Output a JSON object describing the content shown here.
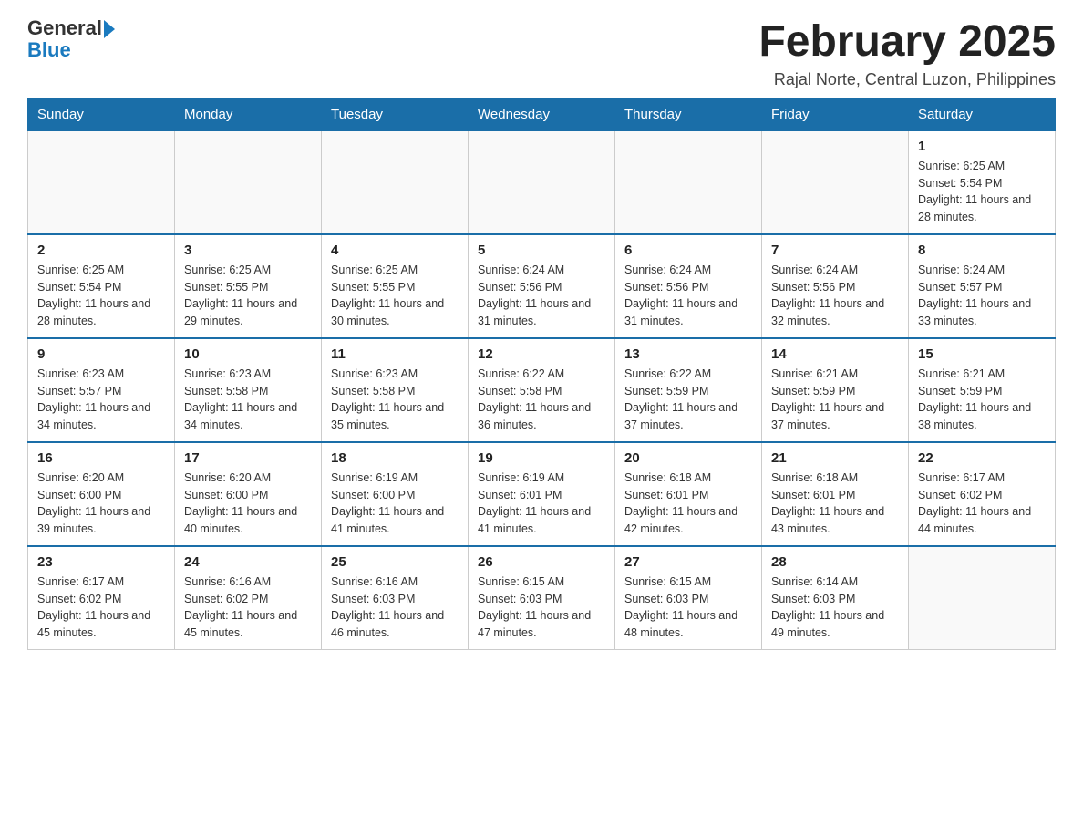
{
  "header": {
    "logo_general": "General",
    "logo_blue": "Blue",
    "month_title": "February 2025",
    "location": "Rajal Norte, Central Luzon, Philippines"
  },
  "days_of_week": [
    "Sunday",
    "Monday",
    "Tuesday",
    "Wednesday",
    "Thursday",
    "Friday",
    "Saturday"
  ],
  "weeks": [
    [
      {
        "day": "",
        "info": ""
      },
      {
        "day": "",
        "info": ""
      },
      {
        "day": "",
        "info": ""
      },
      {
        "day": "",
        "info": ""
      },
      {
        "day": "",
        "info": ""
      },
      {
        "day": "",
        "info": ""
      },
      {
        "day": "1",
        "info": "Sunrise: 6:25 AM\nSunset: 5:54 PM\nDaylight: 11 hours and 28 minutes."
      }
    ],
    [
      {
        "day": "2",
        "info": "Sunrise: 6:25 AM\nSunset: 5:54 PM\nDaylight: 11 hours and 28 minutes."
      },
      {
        "day": "3",
        "info": "Sunrise: 6:25 AM\nSunset: 5:55 PM\nDaylight: 11 hours and 29 minutes."
      },
      {
        "day": "4",
        "info": "Sunrise: 6:25 AM\nSunset: 5:55 PM\nDaylight: 11 hours and 30 minutes."
      },
      {
        "day": "5",
        "info": "Sunrise: 6:24 AM\nSunset: 5:56 PM\nDaylight: 11 hours and 31 minutes."
      },
      {
        "day": "6",
        "info": "Sunrise: 6:24 AM\nSunset: 5:56 PM\nDaylight: 11 hours and 31 minutes."
      },
      {
        "day": "7",
        "info": "Sunrise: 6:24 AM\nSunset: 5:56 PM\nDaylight: 11 hours and 32 minutes."
      },
      {
        "day": "8",
        "info": "Sunrise: 6:24 AM\nSunset: 5:57 PM\nDaylight: 11 hours and 33 minutes."
      }
    ],
    [
      {
        "day": "9",
        "info": "Sunrise: 6:23 AM\nSunset: 5:57 PM\nDaylight: 11 hours and 34 minutes."
      },
      {
        "day": "10",
        "info": "Sunrise: 6:23 AM\nSunset: 5:58 PM\nDaylight: 11 hours and 34 minutes."
      },
      {
        "day": "11",
        "info": "Sunrise: 6:23 AM\nSunset: 5:58 PM\nDaylight: 11 hours and 35 minutes."
      },
      {
        "day": "12",
        "info": "Sunrise: 6:22 AM\nSunset: 5:58 PM\nDaylight: 11 hours and 36 minutes."
      },
      {
        "day": "13",
        "info": "Sunrise: 6:22 AM\nSunset: 5:59 PM\nDaylight: 11 hours and 37 minutes."
      },
      {
        "day": "14",
        "info": "Sunrise: 6:21 AM\nSunset: 5:59 PM\nDaylight: 11 hours and 37 minutes."
      },
      {
        "day": "15",
        "info": "Sunrise: 6:21 AM\nSunset: 5:59 PM\nDaylight: 11 hours and 38 minutes."
      }
    ],
    [
      {
        "day": "16",
        "info": "Sunrise: 6:20 AM\nSunset: 6:00 PM\nDaylight: 11 hours and 39 minutes."
      },
      {
        "day": "17",
        "info": "Sunrise: 6:20 AM\nSunset: 6:00 PM\nDaylight: 11 hours and 40 minutes."
      },
      {
        "day": "18",
        "info": "Sunrise: 6:19 AM\nSunset: 6:00 PM\nDaylight: 11 hours and 41 minutes."
      },
      {
        "day": "19",
        "info": "Sunrise: 6:19 AM\nSunset: 6:01 PM\nDaylight: 11 hours and 41 minutes."
      },
      {
        "day": "20",
        "info": "Sunrise: 6:18 AM\nSunset: 6:01 PM\nDaylight: 11 hours and 42 minutes."
      },
      {
        "day": "21",
        "info": "Sunrise: 6:18 AM\nSunset: 6:01 PM\nDaylight: 11 hours and 43 minutes."
      },
      {
        "day": "22",
        "info": "Sunrise: 6:17 AM\nSunset: 6:02 PM\nDaylight: 11 hours and 44 minutes."
      }
    ],
    [
      {
        "day": "23",
        "info": "Sunrise: 6:17 AM\nSunset: 6:02 PM\nDaylight: 11 hours and 45 minutes."
      },
      {
        "day": "24",
        "info": "Sunrise: 6:16 AM\nSunset: 6:02 PM\nDaylight: 11 hours and 45 minutes."
      },
      {
        "day": "25",
        "info": "Sunrise: 6:16 AM\nSunset: 6:03 PM\nDaylight: 11 hours and 46 minutes."
      },
      {
        "day": "26",
        "info": "Sunrise: 6:15 AM\nSunset: 6:03 PM\nDaylight: 11 hours and 47 minutes."
      },
      {
        "day": "27",
        "info": "Sunrise: 6:15 AM\nSunset: 6:03 PM\nDaylight: 11 hours and 48 minutes."
      },
      {
        "day": "28",
        "info": "Sunrise: 6:14 AM\nSunset: 6:03 PM\nDaylight: 11 hours and 49 minutes."
      },
      {
        "day": "",
        "info": ""
      }
    ]
  ]
}
